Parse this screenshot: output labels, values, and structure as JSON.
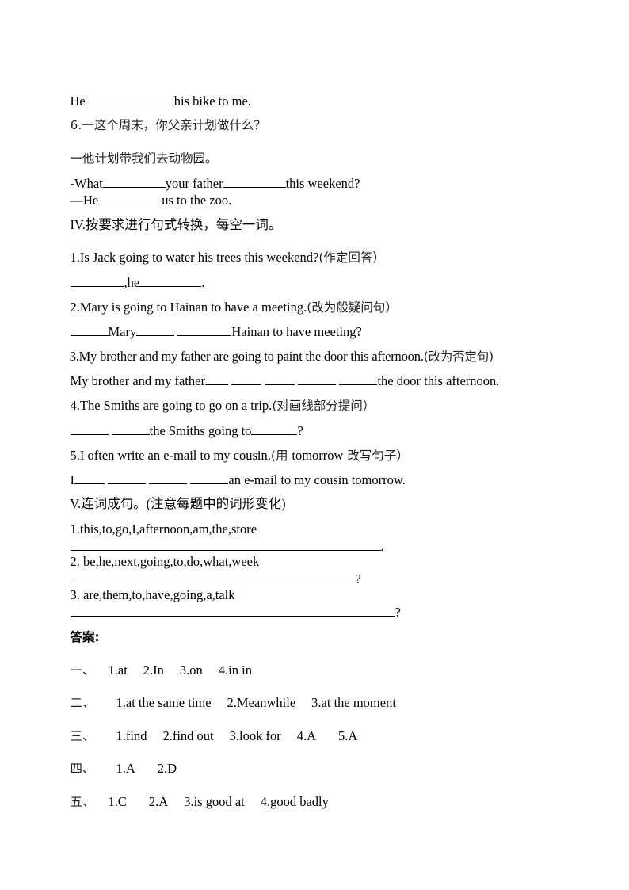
{
  "section_prev": {
    "q5_line": {
      "pre": "He",
      "post": "his bike to me."
    }
  },
  "q6": {
    "prompt": "6.一这个周末，你父亲计划做什么？",
    "answer_cn": "一他计划带我们去动物园。",
    "line1": {
      "pre": "-What",
      "mid": "your father",
      "post": "this weekend?"
    },
    "line2": {
      "pre": "—He",
      "post": "us to the zoo."
    }
  },
  "section_iv": {
    "title": "IV.按要求进行句式转换，每空一词。",
    "items": [
      {
        "question": "1.Is Jack going to water his trees this weekend?",
        "instruction": "(作定回答）",
        "answer": {
          "mid": ",he",
          "post": "."
        }
      },
      {
        "question": "2.Mary is going to Hainan to have a meeting.",
        "instruction": "(改为般疑问句）",
        "answer": {
          "mid1": "Mary",
          "post": "Hainan to have meeting?"
        }
      },
      {
        "question": "3.My brother and my father are going to paint the door this afternoon.",
        "instruction": "(改为否定句)",
        "answer": {
          "pre": "My brother and my father",
          "post": "the door this afternoon."
        }
      },
      {
        "question": "4.The Smiths are going to go on a trip.",
        "instruction": "(对画线部分提问）",
        "answer": {
          "mid": "the Smiths going to",
          "post": "?"
        }
      },
      {
        "question": "5.I often write an e-mail to my cousin.",
        "instruction_pre": "(用 ",
        "instruction_word": "tomorrow",
        "instruction_post": " 改写句子）",
        "answer": {
          "pre": "I",
          "post": "an e-mail to my cousin tomorrow."
        }
      }
    ]
  },
  "section_v": {
    "title": "V.连词成句。(注意每题中的词形变化)",
    "items": [
      {
        "words": "1.this,to,go,I,afternoon,am,the,store",
        "end": "."
      },
      {
        "words": "2. be,he,next,going,to,do,what,week",
        "end": "?"
      },
      {
        "words": "3. are,them,to,have,going,a,talk",
        "end": "?"
      }
    ]
  },
  "answers": {
    "title": "答案:",
    "rows": [
      {
        "label": "一、",
        "items": [
          "1.at",
          "2.In",
          "3.on",
          "4.in in"
        ]
      },
      {
        "label": "二、",
        "items": [
          "1.at the same time",
          "2.Meanwhile",
          "3.at the moment"
        ]
      },
      {
        "label": "三、",
        "items": [
          "1.find",
          "2.find out",
          "3.look for",
          "4.A",
          "5.A"
        ]
      },
      {
        "label": "四、",
        "items": [
          "1.A",
          "2.D"
        ]
      },
      {
        "label": "五、",
        "items": [
          "1.C",
          "2.A",
          "3.is good at",
          "4.good badly"
        ]
      }
    ]
  }
}
